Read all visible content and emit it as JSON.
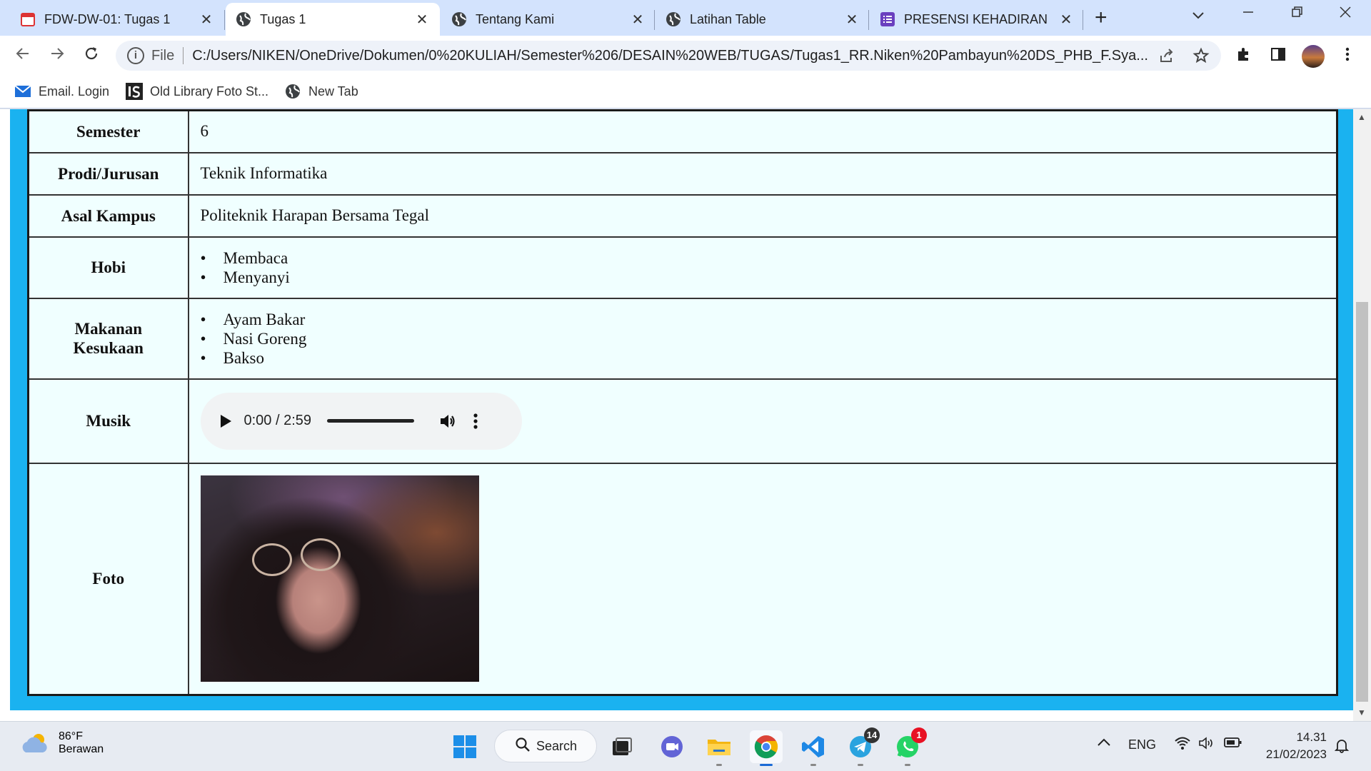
{
  "browser": {
    "tabs": [
      {
        "label": "FDW-DW-01: Tugas 1",
        "icon": "calendar-icon",
        "active": false
      },
      {
        "label": "Tugas 1",
        "icon": "globe-icon",
        "active": true
      },
      {
        "label": "Tentang Kami",
        "icon": "globe-icon",
        "active": false
      },
      {
        "label": "Latihan Table",
        "icon": "globe-icon",
        "active": false
      },
      {
        "label": "PRESENSI KEHADIRAN",
        "icon": "form-icon",
        "active": false
      }
    ],
    "close_glyph": "✕",
    "new_tab_glyph": "+",
    "address": {
      "scheme_label": "File",
      "url": "C:/Users/NIKEN/OneDrive/Dokumen/0%20KULIAH/Semester%206/DESAIN%20WEB/TUGAS/Tugas1_RR.Niken%20Pambayun%20DS_PHB_F.Sya..."
    },
    "bookmarks": [
      {
        "label": "Email. Login",
        "icon": "mail-icon"
      },
      {
        "label": "Old Library Foto St...",
        "icon": "ls-logo-icon"
      },
      {
        "label": "New Tab",
        "icon": "globe-icon"
      }
    ]
  },
  "biodata": {
    "rows": {
      "semester": {
        "label": "Semester",
        "value": "6"
      },
      "prodi": {
        "label": "Prodi/Jurusan",
        "value": "Teknik Informatika"
      },
      "kampus": {
        "label": "Asal Kampus",
        "value": "Politeknik Harapan Bersama Tegal"
      },
      "hobi": {
        "label": "Hobi",
        "items": [
          "Membaca",
          "Menyanyi"
        ]
      },
      "makanan": {
        "label": "Makanan Kesukaan",
        "items": [
          "Ayam Bakar",
          "Nasi Goreng",
          "Bakso"
        ]
      },
      "musik": {
        "label": "Musik",
        "audio_time": "0:00 / 2:59",
        "progress": 0
      },
      "foto": {
        "label": "Foto"
      }
    }
  },
  "taskbar": {
    "weather": {
      "temp": "86°F",
      "condition": "Berawan"
    },
    "search_label": "Search",
    "apps": [
      {
        "name": "start",
        "icon": "windows-icon"
      },
      {
        "name": "task-view",
        "icon": "task-view-icon"
      },
      {
        "name": "meet",
        "icon": "camera-chat-icon"
      },
      {
        "name": "file-explorer",
        "icon": "folder-icon"
      },
      {
        "name": "chrome",
        "icon": "chrome-icon"
      },
      {
        "name": "vscode",
        "icon": "vscode-icon"
      },
      {
        "name": "telegram",
        "icon": "telegram-icon",
        "badge": "14"
      },
      {
        "name": "whatsapp",
        "icon": "whatsapp-icon",
        "badge": "1"
      }
    ],
    "tray": {
      "language": "ENG"
    },
    "clock": {
      "time": "14.31",
      "date": "21/02/2023"
    }
  },
  "colors": {
    "page_frame": "#1ab2f0",
    "table_bg": "#f0ffff",
    "tab_strip": "#d3e3fd"
  }
}
